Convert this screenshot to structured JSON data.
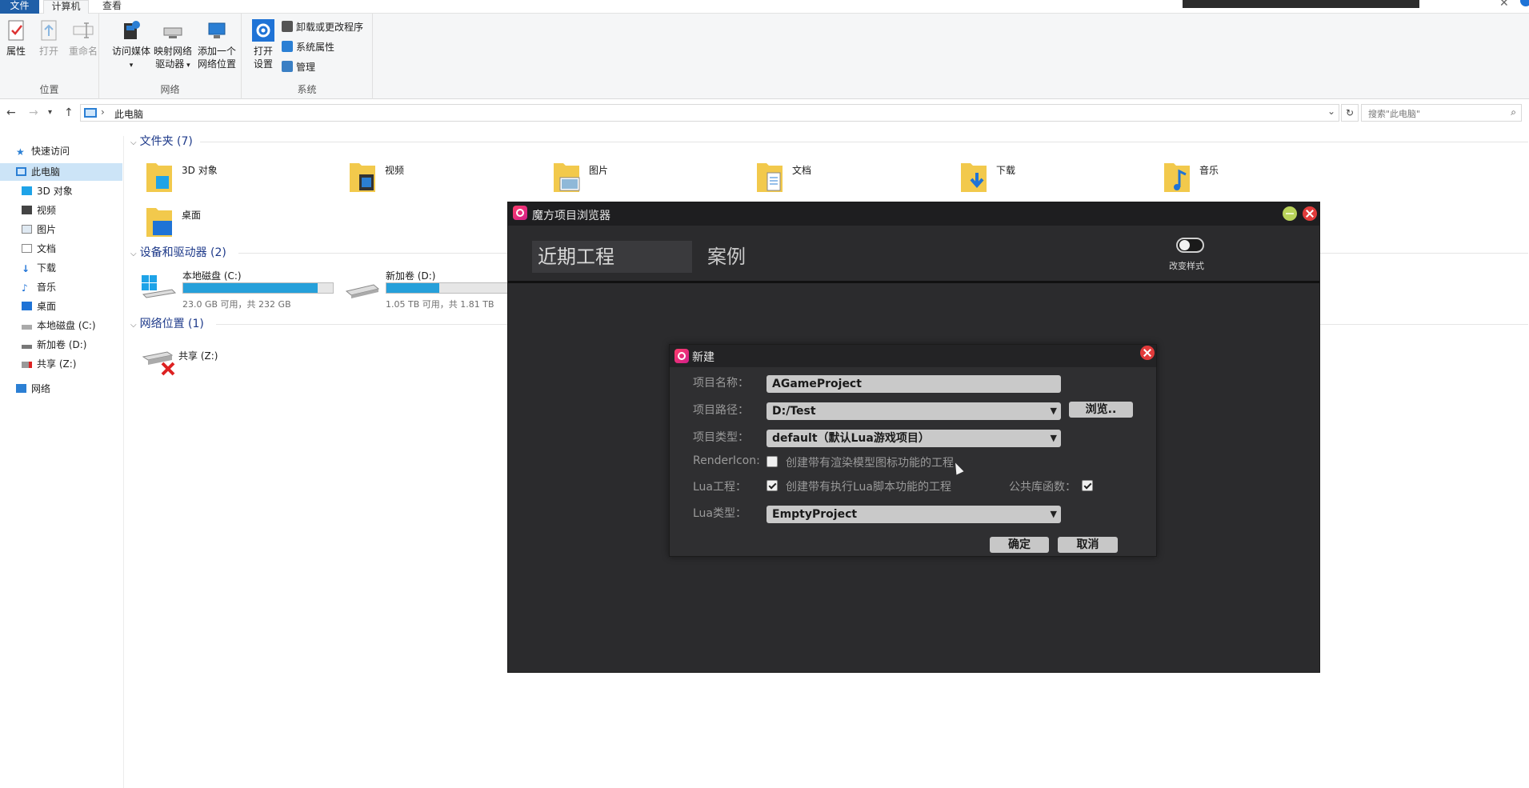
{
  "ribbon": {
    "tabs": [
      "文件",
      "计算机",
      "查看"
    ],
    "groups": {
      "location": {
        "title": "位置",
        "buttons": [
          "属性",
          "打开",
          "重命名"
        ]
      },
      "network": {
        "title": "网络",
        "access_media": "访问媒体",
        "map_drive_line1": "映射网络",
        "map_drive_line2": "驱动器",
        "add_location_line1": "添加一个",
        "add_location_line2": "网络位置"
      },
      "system": {
        "title": "系统",
        "open_settings_line1": "打开",
        "open_settings_line2": "设置",
        "uninstall": "卸载或更改程序",
        "sys_props": "系统属性",
        "manage": "管理"
      }
    }
  },
  "address": {
    "path": "此电脑",
    "search_placeholder": "搜索\"此电脑\""
  },
  "sidebar": {
    "quick_access": "快速访问",
    "this_pc": "此电脑",
    "items": [
      "3D 对象",
      "视频",
      "图片",
      "文档",
      "下载",
      "音乐",
      "桌面",
      "本地磁盘 (C:)",
      "新加卷 (D:)",
      "共享 (Z:)"
    ],
    "network": "网络"
  },
  "content": {
    "folders_header": "文件夹 (7)",
    "folders": [
      "3D 对象",
      "视频",
      "图片",
      "文档",
      "下载",
      "音乐",
      "桌面"
    ],
    "drives_header": "设备和驱动器 (2)",
    "drives": [
      {
        "name": "本地磁盘 (C:)",
        "info": "23.0 GB 可用，共 232 GB",
        "used_fraction": 0.9
      },
      {
        "name": "新加卷 (D:)",
        "info": "1.05 TB 可用，共 1.81 TB",
        "used_fraction": 0.42
      }
    ],
    "network_header": "网络位置 (1)",
    "network_items": [
      "共享 (Z:)"
    ]
  },
  "browser": {
    "title": "魔方项目浏览器",
    "tab_recent": "近期工程",
    "tab_cases": "案例",
    "toggle_label": "改变样式"
  },
  "dialog": {
    "title": "新建",
    "name_label": "项目名称：",
    "name_value": "AGameProject",
    "path_label": "项目路径：",
    "path_value": "D:/Test",
    "browse": "浏览..",
    "type_label": "项目类型：",
    "type_value": "default（默认Lua游戏项目）",
    "render_label": "RenderIcon:",
    "render_text": "创建带有渲染模型图标功能的工程",
    "render_checked": false,
    "lua_label": "Lua工程：",
    "lua_text": "创建带有执行Lua脚本功能的工程",
    "lua_checked": true,
    "public_label": "公共库函数：",
    "public_checked": true,
    "luatype_label": "Lua类型：",
    "luatype_value": "EmptyProject",
    "ok": "确定",
    "cancel": "取消"
  },
  "colors": {
    "accent": "#1f5fa8",
    "drive_fill": "#26a0da",
    "dark_bg": "#2b2b2d",
    "close_red": "#e23b3b",
    "min_green": "#b9d35a"
  }
}
